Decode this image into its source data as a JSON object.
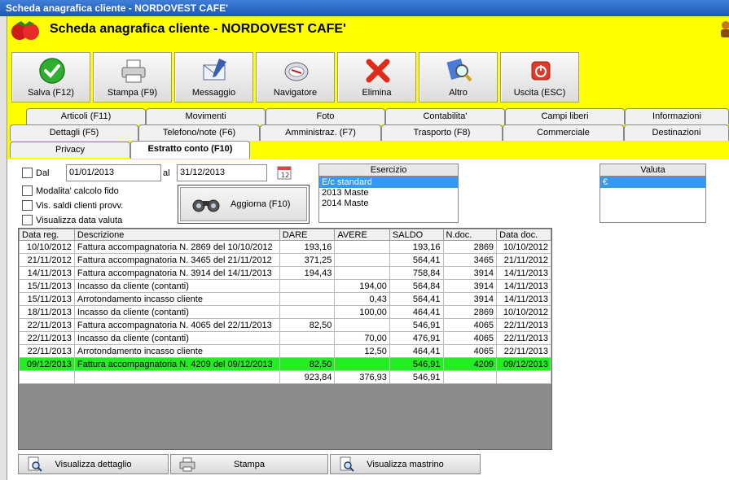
{
  "window": {
    "title": "Scheda anagrafica cliente - NORDOVEST CAFE'"
  },
  "header": {
    "title": "Scheda anagrafica cliente - NORDOVEST CAFE'"
  },
  "toolbar": [
    {
      "id": "save",
      "label": "Salva (F12)",
      "icon": "check-icon"
    },
    {
      "id": "print",
      "label": "Stampa (F9)",
      "icon": "printer-icon"
    },
    {
      "id": "message",
      "label": "Messaggio",
      "icon": "envelope-pen-icon"
    },
    {
      "id": "navigator",
      "label": "Navigatore",
      "icon": "compass-icon"
    },
    {
      "id": "delete",
      "label": "Elimina",
      "icon": "red-x-icon"
    },
    {
      "id": "other",
      "label": "Altro",
      "icon": "magnifier-icon"
    },
    {
      "id": "exit",
      "label": "Uscita (ESC)",
      "icon": "power-icon"
    }
  ],
  "tabs": {
    "row1": [
      "Articoli (F11)",
      "Movimenti",
      "Foto",
      "Contabilita'",
      "Campi liberi",
      "Informazioni"
    ],
    "row2": [
      "Dettagli (F5)",
      "Telefono/note (F6)",
      "Amministraz. (F7)",
      "Trasporto (F8)",
      "Commerciale",
      "Destinazioni"
    ],
    "row3": [
      "Privacy",
      "Estratto conto (F10)"
    ],
    "active": "Estratto conto (F10)"
  },
  "filters": {
    "dal_label": "Dal",
    "date_from": "01/01/2013",
    "al_label": "al",
    "date_to": "31/12/2013",
    "options": [
      "Modalita' calcolo fido",
      "Vis. saldi clienti provv.",
      "Visualizza data valuta"
    ],
    "refresh_label": "Aggiorna (F10)"
  },
  "esercizio": {
    "header": "Esercizio",
    "items": [
      "E/c standard",
      "2013 Maste",
      "2014 Maste"
    ],
    "selected": 0
  },
  "valuta": {
    "header": "Valuta",
    "items": [
      "€"
    ],
    "selected": 0
  },
  "grid": {
    "columns": [
      "Data reg.",
      "Descrizione",
      "DARE",
      "AVERE",
      "SALDO",
      "N.doc.",
      "Data doc."
    ],
    "rows": [
      [
        "10/10/2012",
        "Fattura accompagnatoria N. 2869 del 10/10/2012",
        "193,16",
        "",
        "193,16",
        "2869",
        "10/10/2012"
      ],
      [
        "21/11/2012",
        "Fattura accompagnatoria N. 3465 del 21/11/2012",
        "371,25",
        "",
        "564,41",
        "3465",
        "21/11/2012"
      ],
      [
        "14/11/2013",
        "Fattura accompagnatoria N. 3914 del 14/11/2013",
        "194,43",
        "",
        "758,84",
        "3914",
        "14/11/2013"
      ],
      [
        "15/11/2013",
        "Incasso da cliente (contanti)",
        "",
        "194,00",
        "564,84",
        "3914",
        "14/11/2013"
      ],
      [
        "15/11/2013",
        "Arrotondamento incasso cliente",
        "",
        "0,43",
        "564,41",
        "3914",
        "14/11/2013"
      ],
      [
        "18/11/2013",
        "Incasso da cliente (contanti)",
        "",
        "100,00",
        "464,41",
        "2869",
        "10/10/2012"
      ],
      [
        "22/11/2013",
        "Fattura accompagnatoria N. 4065 del 22/11/2013",
        "82,50",
        "",
        "546,91",
        "4065",
        "22/11/2013"
      ],
      [
        "22/11/2013",
        "Incasso da cliente (contanti)",
        "",
        "70,00",
        "476,91",
        "4065",
        "22/11/2013"
      ],
      [
        "22/11/2013",
        "Arrotondamento incasso cliente",
        "",
        "12,50",
        "464,41",
        "4065",
        "22/11/2013"
      ],
      [
        "09/12/2013",
        "Fattura accompagnatoria N. 4209 del 09/12/2013",
        "82,50",
        "",
        "546,91",
        "4209",
        "09/12/2013"
      ]
    ],
    "highlight_row": 9,
    "totals": [
      "",
      "",
      "923,84",
      "376,93",
      "546,91",
      "",
      ""
    ]
  },
  "bottom_buttons": [
    {
      "label": "Visualizza dettaglio",
      "icon": "magnifier-doc-icon"
    },
    {
      "label": "Stampa",
      "icon": "printer-icon"
    },
    {
      "label": "Visualizza mastrino",
      "icon": "magnifier-doc-icon"
    }
  ],
  "colors": {
    "background": "#ffff00",
    "highlight": "#22ee22",
    "selection": "#3399ff",
    "titlebar": "#1c57b8"
  }
}
